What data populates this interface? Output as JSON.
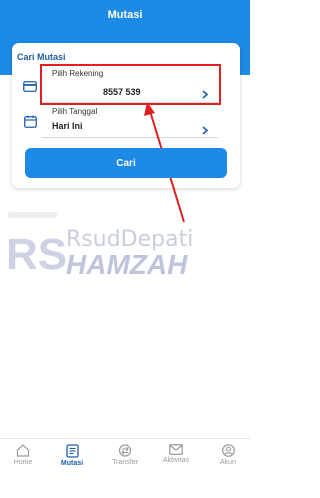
{
  "header": {
    "title": "Mutasi"
  },
  "card": {
    "title": "Cari Mutasi",
    "account": {
      "label": "Pilih Rekening",
      "value": "8557 539"
    },
    "date": {
      "label": "Pilih Tanggal",
      "value": "Hari Ini"
    },
    "search_label": "Cari"
  },
  "watermark": {
    "logo_text": "RS",
    "line1": "RsudDepati",
    "line2": "HAMZAH"
  },
  "nav": {
    "items": [
      {
        "label": "Home",
        "icon": "home-icon"
      },
      {
        "label": "Mutasi",
        "icon": "mutasi-icon"
      },
      {
        "label": "Transfer",
        "icon": "transfer-icon"
      },
      {
        "label": "Aktivitas",
        "icon": "mail-icon"
      },
      {
        "label": "Akun",
        "icon": "user-icon"
      }
    ]
  },
  "colors": {
    "primary": "#1d8ae6",
    "title_blue": "#1f5fa8",
    "highlight": "#e02020"
  }
}
